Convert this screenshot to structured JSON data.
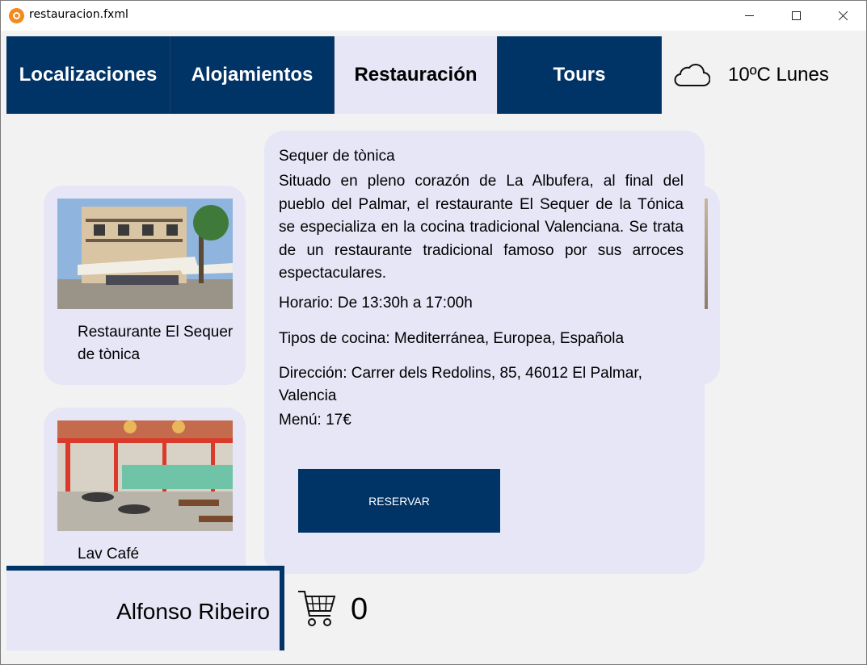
{
  "window": {
    "title": "restauracion.fxml"
  },
  "tabs": [
    {
      "label": "Localizaciones",
      "active": false
    },
    {
      "label": "Alojamientos",
      "active": false
    },
    {
      "label": "Restauración",
      "active": true
    },
    {
      "label": "Tours",
      "active": false
    }
  ],
  "weather": {
    "icon": "cloud-icon",
    "text": "10ºC Lunes"
  },
  "restaurants": [
    {
      "name": "Restaurante El Sequer de tònica",
      "image": "restaurant-facade-photo"
    },
    {
      "name": "Lav Café",
      "image": "cafe-interior-photo"
    }
  ],
  "detail": {
    "title": "Sequer de tònica",
    "description": "Situado en pleno corazón de La Albufera, al final del pueblo del Palmar, el restaurante El Sequer de la Tónica se especializa en la cocina tradicional Valenciana. Se trata de un restaurante tradicional famoso por sus arroces espectaculares.",
    "hours": "Horario: De 13:30h a 17:00h",
    "cuisine": "Tipos de cocina: Mediterránea, Europea, Española",
    "address": "Dirección: Carrer dels Redolins, 85, 46012 El Palmar, Valencia",
    "menu": "Menú: 17€",
    "reserve_label": "RESERVAR"
  },
  "user": {
    "name": "Alfonso Ribeiro"
  },
  "cart": {
    "icon": "cart-icon",
    "count": "0"
  },
  "colors": {
    "primary": "#003366",
    "card_bg": "#e6e6f7",
    "window_bg": "#f2f2f2"
  }
}
